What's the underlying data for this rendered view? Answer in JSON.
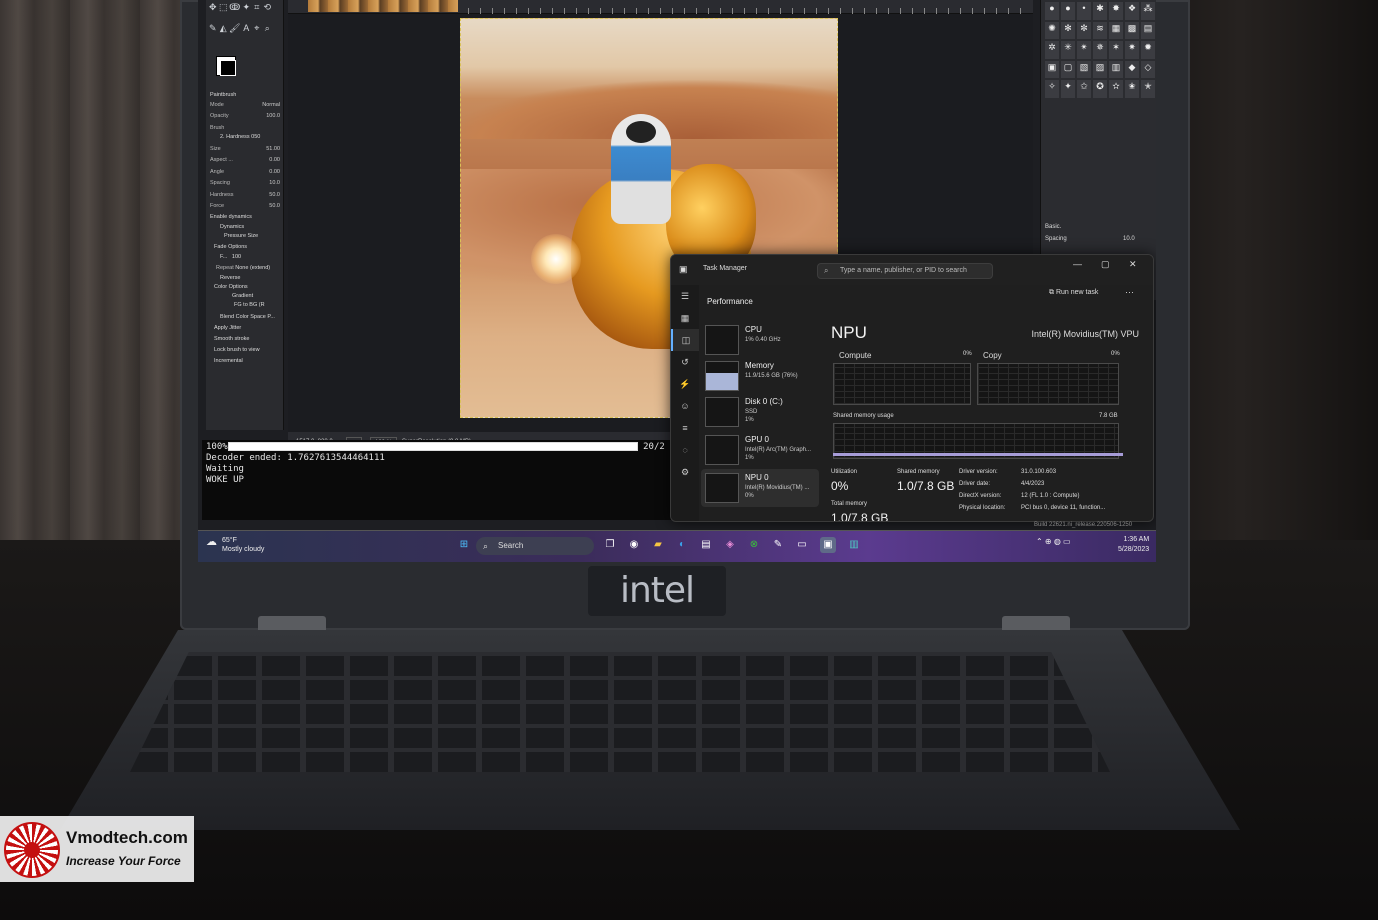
{
  "gimp": {
    "tool_options_title": "Paintbrush",
    "mode_label": "Mode",
    "mode_value": "Normal",
    "opacity_label": "Opacity",
    "opacity_value": "100.0",
    "brush_label": "Brush",
    "brush_value": "2. Hardness 050",
    "size_label": "Size",
    "size_value": "51.00",
    "aspect_label": "Aspect ...",
    "aspect_value": "0.00",
    "angle_label": "Angle",
    "angle_value": "0.00",
    "spacing_label": "Spacing",
    "spacing_value": "10.0",
    "hardness_label": "Hardness",
    "hardness_value": "50.0",
    "force_label": "Force",
    "force_value": "50.0",
    "enable_dynamics": "Enable dynamics",
    "dynamics_label": "Dynamics",
    "dynamics_value": "Pressure Size",
    "fade_options": "Fade Options",
    "repeat_label": "Repeat",
    "repeat_value": "None (extend)",
    "reverse_label": "Reverse",
    "color_options": "Color Options",
    "gradient_label": "Gradient",
    "gradient_value": "FG to BG (R",
    "blend_label": "Blend Color Space P...",
    "apply_jitter": "Apply Jitter",
    "smooth_stroke": "Smooth stroke",
    "lock_brush": "Lock brush to view",
    "incremental": "Incremental",
    "coords": "1517.0, 828.0",
    "unit": "px",
    "zoom": "100 %",
    "status": "SuperResolution (9.8 MB)",
    "right_panel_label": "Basic.",
    "right_spacing_label": "Spacing",
    "right_spacing_value": "10.0"
  },
  "terminal": {
    "percent": "100%",
    "progress_fraction": 1.0,
    "progress_right": "20/2",
    "line_decoder": "Decoder ended: 1.7627613544464111",
    "line_waiting": "Waiting",
    "line_woke": "WOKE UP"
  },
  "task_manager": {
    "title": "Task Manager",
    "search_placeholder": "Type a name, publisher, or PID to search",
    "section": "Performance",
    "run_new_task": "Run new task",
    "items": [
      {
        "name": "CPU",
        "sub": "1% 0.40 GHz",
        "sub2": ""
      },
      {
        "name": "Memory",
        "sub": "11.9/15.6 GB (76%)",
        "sub2": ""
      },
      {
        "name": "Disk 0 (C:)",
        "sub": "SSD",
        "sub2": "1%"
      },
      {
        "name": "GPU 0",
        "sub": "Intel(R) Arc(TM) Graph...",
        "sub2": "1%"
      },
      {
        "name": "NPU 0",
        "sub": "Intel(R) Movidius(TM) ...",
        "sub2": "0%"
      }
    ],
    "detail_title": "NPU",
    "device_name": "Intel(R) Movidius(TM) VPU",
    "compute_label": "Compute",
    "compute_pct": "0%",
    "copy_label": "Copy",
    "copy_pct": "0%",
    "shared_usage_label": "Shared memory usage",
    "shared_usage_max": "7.8 GB",
    "utilization_label": "Utilization",
    "utilization_value": "0%",
    "shared_memory_label": "Shared memory",
    "shared_memory_value": "1.0/7.8 GB",
    "total_memory_label": "Total memory",
    "total_memory_value": "1.0/7.8 GB",
    "driver_version_label": "Driver version:",
    "driver_version_value": "31.0.100.603",
    "driver_date_label": "Driver date:",
    "driver_date_value": "4/4/2023",
    "directx_label": "DirectX version:",
    "directx_value": "12 (FL 1.0 : Compute)",
    "physical_label": "Physical location:",
    "physical_value": "PCI bus 0, device 11, function..."
  },
  "taskbar": {
    "temperature": "65°F",
    "weather": "Mostly cloudy",
    "search_label": "Search",
    "time": "1:36 AM",
    "date": "5/28/2023",
    "build_text": "Build 22621.ni_release.220506-1250"
  },
  "laptop": {
    "brand": "intel"
  },
  "watermark": {
    "site": "Vmodtech.com",
    "tagline": "Increase Your Force"
  },
  "colors": {
    "accent_blue": "#64b0ff",
    "shared_memory_line": "#a79cd8",
    "watermark_red": "#c41010"
  }
}
